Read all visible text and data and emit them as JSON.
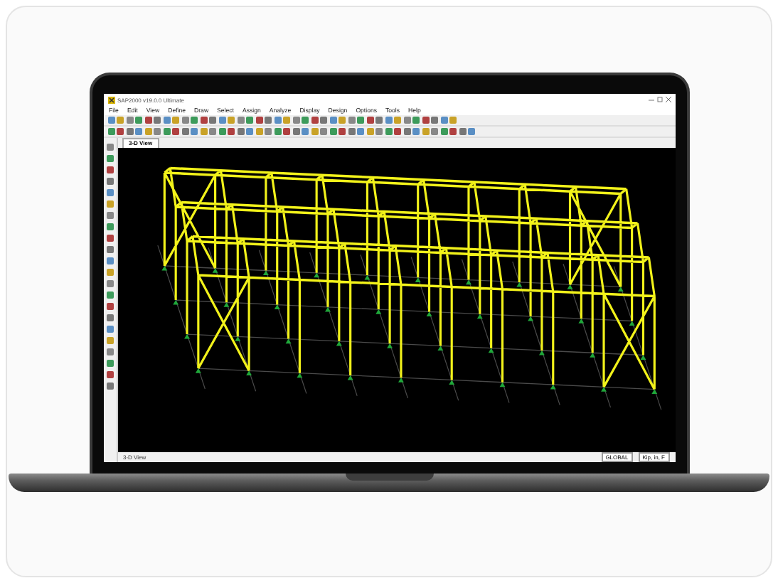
{
  "window": {
    "title": "SAP2000 v19.0.0 Ultimate"
  },
  "menu": [
    "File",
    "Edit",
    "View",
    "Define",
    "Draw",
    "Select",
    "Assign",
    "Analyze",
    "Display",
    "Design",
    "Options",
    "Tools",
    "Help"
  ],
  "view_tab": {
    "label": "3-D View",
    "selected": true
  },
  "status_bar": {
    "text": "3-D View",
    "coordinate_system": "GLOBAL",
    "units": "Kip, in, F"
  }
}
